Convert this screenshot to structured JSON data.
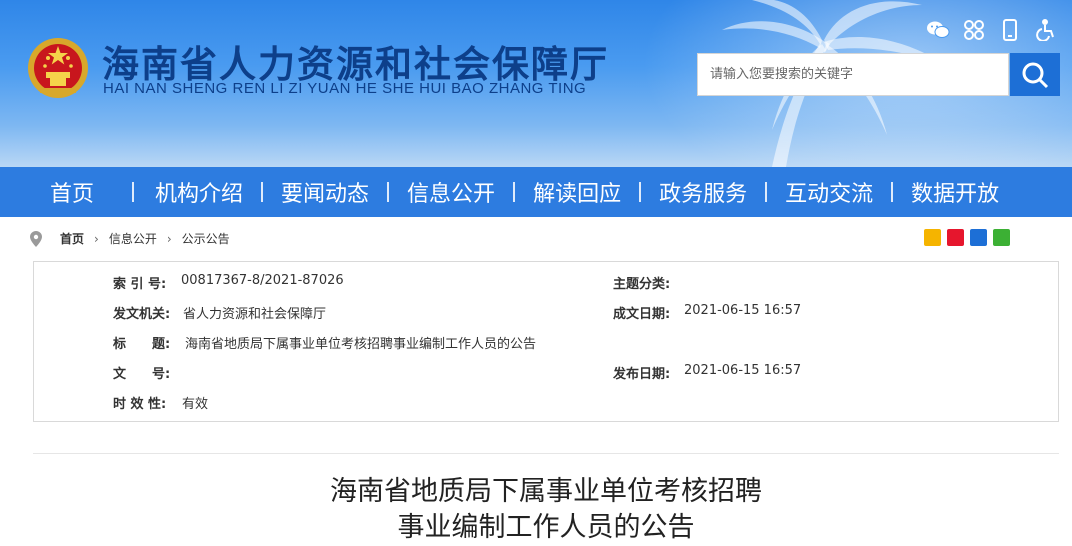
{
  "header": {
    "title": "海南省人力资源和社会保障厅",
    "subtitle": "HAI NAN SHENG REN LI ZI YUAN HE SHE HUI BAO ZHANG TING",
    "search_placeholder": "请输入您要搜索的关键字",
    "tools": [
      "wechat-icon",
      "app-grid-icon",
      "mobile-icon",
      "accessibility-icon"
    ]
  },
  "nav": {
    "items": [
      "首页",
      "机构介绍",
      "要闻动态",
      "信息公开",
      "解读回应",
      "政务服务",
      "互动交流",
      "数据开放"
    ]
  },
  "breadcrumb": {
    "items": [
      "首页",
      "信息公开",
      "公示公告"
    ]
  },
  "share": [
    "qzone-share-icon",
    "weibo-share-icon",
    "renren-share-icon",
    "wechat-share-icon"
  ],
  "meta": {
    "index_label": "索 引 号:",
    "index_value": "00817367-8/2021-87026",
    "topic_label": "主题分类:",
    "topic_value": "",
    "issuer_label": "发文机关:",
    "issuer_value": "省人力资源和社会保障厅",
    "created_label": "成文日期:",
    "created_value": "2021-06-15 16:57",
    "title_label": "标　　题:",
    "title_value": "海南省地质局下属事业单位考核招聘事业编制工作人员的公告",
    "docno_label": "文　　号:",
    "docno_value": "",
    "published_label": "发布日期:",
    "published_value": "2021-06-15 16:57",
    "validity_label": "时 效 性:",
    "validity_value": "有效"
  },
  "article": {
    "title_line1": "海南省地质局下属事业单位考核招聘",
    "title_line2": "事业编制工作人员的公告"
  },
  "colors": {
    "nav_bg": "#2d7ce0",
    "title_color": "#0d3f8a",
    "search_btn": "#1d6fd6"
  }
}
